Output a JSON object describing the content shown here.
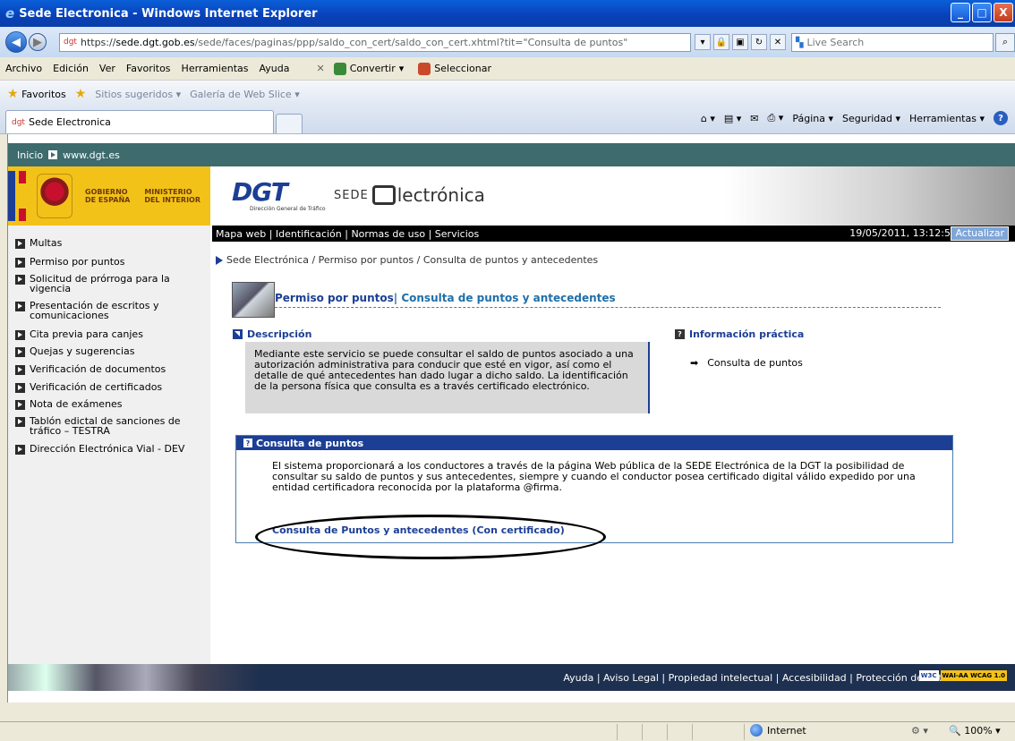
{
  "window": {
    "title": "Sede Electronica - Windows Internet Explorer",
    "buttons": {
      "minimize": "_",
      "maximize": "□",
      "close": "X"
    }
  },
  "address_bar": {
    "url_scheme": "https://",
    "url_host": "sede.dgt.gob.es",
    "url_path": "/sede/faces/paginas/ppp/saldo_con_cert/saldo_con_cert.xhtml?tit=\"Consulta de puntos\"",
    "search_placeholder": "Live Search"
  },
  "menu": {
    "items": [
      "Archivo",
      "Edición",
      "Ver",
      "Favoritos",
      "Herramientas",
      "Ayuda"
    ],
    "convertir": "Convertir",
    "seleccionar": "Seleccionar"
  },
  "favorites_bar": {
    "favoritos": "Favoritos",
    "sugeridos": "Sitios sugeridos",
    "galeria": "Galería de Web Slice"
  },
  "tab": {
    "label": "Sede Electronica"
  },
  "command_bar": {
    "pagina": "Página",
    "seguridad": "Seguridad",
    "herramientas": "Herramientas"
  },
  "site": {
    "top_strip": {
      "inicio": "Inicio",
      "dgt_link": "www.dgt.es"
    },
    "banner": {
      "gobierno": "GOBIERNO\nDE ESPAÑA",
      "ministerio": "MINISTERIO\nDEL INTERIOR",
      "dgt": "DGT",
      "dgt_sub": "Dirección General de Tráfico",
      "sede": "SEDE",
      "lectronica": "lectrónica"
    },
    "topmenu": {
      "links": "Mapa web | Identificación | Normas de uso | Servicios",
      "datetime": "19/05/2011, 13:12:55",
      "update_button": "Actualizar"
    },
    "left_nav": [
      "Multas",
      "Permiso por puntos",
      "Solicitud de prórroga para la vigencia",
      "Presentación de escritos y comunicaciones",
      "Cita previa para canjes",
      "Quejas y sugerencias",
      "Verificación de documentos",
      "Verificación de certificados",
      "Nota de exámenes",
      "Tablón edictal de sanciones de tráfico – TESTRA",
      "Dirección Electrónica Vial - DEV"
    ],
    "breadcrumb": "Sede Electrónica  / Permiso por puntos  / Consulta de puntos y antecedentes",
    "page_title": {
      "main": "Permiso por puntos",
      "sub": "| Consulta de puntos y antecedentes"
    },
    "descripcion": {
      "heading": "Descripción",
      "text": "Mediante este servicio se puede consultar el saldo de puntos asociado a una autorización administrativa para conducir que esté en vigor, así como el detalle de qué antecedentes han dado lugar a dicho saldo. La identificación de la persona física que consulta es a través certificado electrónico."
    },
    "info_practica": {
      "heading": "Información práctica",
      "link": "Consulta de puntos"
    },
    "consulta_box": {
      "heading": "Consulta de puntos",
      "text": "El sistema proporcionará a los conductores a través de la página Web pública de la SEDE Electrónica de la DGT la posibilidad de consultar su saldo de puntos y sus antecedentes, siempre y cuando el conductor posea certificado digital válido expedido por una entidad certificadora reconocida por la plataforma @firma.",
      "link": "Consulta de Puntos y antecedentes (Con certificado)"
    },
    "footer": {
      "links": "Ayuda | Aviso Legal | Propiedad intelectual | Accesibilidad | Protección de datos",
      "w3c": "W3C",
      "wai": "WAI-AA WCAG 1.0"
    }
  },
  "status_bar": {
    "zone": "Internet",
    "zoom": "100%"
  }
}
